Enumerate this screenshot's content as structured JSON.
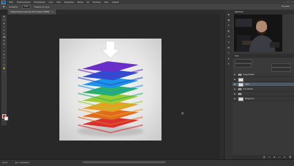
{
  "menubar": {
    "logo": "Ps",
    "items": [
      "Файл",
      "Редактирование",
      "Изображение",
      "Слои",
      "Текст",
      "Выделение",
      "Фильтр",
      "3D",
      "Просмотр",
      "Окно",
      "Справка"
    ]
  },
  "window_controls": {
    "minimize": "–",
    "maximize": "□",
    "close": "×"
  },
  "options_bar": {
    "tool": "✥",
    "auto_select_label": "Автовыбор:",
    "auto_select_value": "Слой",
    "transform_label": "Показать упр. элем.",
    "mode_label": "3D-режим:"
  },
  "document_tab": {
    "title": "Пример Иконки в Layers @ 16,7% (Черпак, RGB/8) *",
    "close": "×"
  },
  "toolbar": {
    "tools": [
      "✥",
      "▭",
      "ʘ",
      "⌖",
      "✂",
      "✒",
      "⌫",
      "✎",
      "⎘",
      "◔",
      "◐",
      "▲",
      "T",
      "↖",
      "▭",
      "✋",
      "⌕"
    ]
  },
  "colors": {
    "foreground": "#d22323",
    "background": "#ffffff",
    "layers": [
      "#6a2fc8",
      "#2b4fd0",
      "#1b94e8",
      "#2ab069",
      "#9acd32",
      "#e8a020",
      "#e06a1e",
      "#d93030"
    ]
  },
  "status_bar": {
    "zoom": "16,67%",
    "doc_info": "Док: 11,3M/248,1M"
  },
  "panels": {
    "top_title": "Навигатор",
    "layers_title": "Слои",
    "layers": [
      {
        "name": "Image Pediwell",
        "type": "folder"
      },
      {
        "name": "",
        "type": "layer"
      },
      {
        "name": "object",
        "type": "layer"
      },
      {
        "name": "Inner Shadow",
        "type": "folder"
      },
      {
        "name": "",
        "type": "folder"
      },
      {
        "name": "Background",
        "type": "layer"
      }
    ]
  },
  "icon_strip": [
    "◆",
    "▦",
    "☰",
    "◧",
    "⚙",
    "◎",
    "▤",
    "✎",
    "◈",
    "¶"
  ]
}
